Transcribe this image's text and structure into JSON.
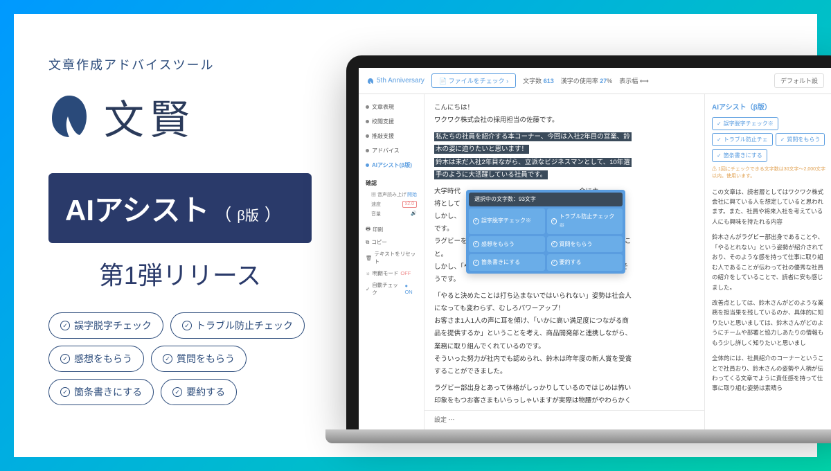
{
  "promo": {
    "tagline": "文章作成アドバイスツール",
    "product_name": "文賢",
    "headline_main": "AIアシスト",
    "headline_sub_open": "（",
    "headline_sub": "β版",
    "headline_sub_close": "）",
    "release": "第1弾リリース",
    "features": [
      "誤字脱字チェック",
      "トラブル防止チェック",
      "感想をもらう",
      "質問をもらう",
      "箇条書きにする",
      "要約する"
    ]
  },
  "app": {
    "topbar": {
      "anniversary": "5th Anniversary",
      "file_check": "ファイルをチェック",
      "char_count_label": "文字数",
      "char_count_value": "613",
      "kanji_ratio_label": "漢字の使用率",
      "kanji_ratio_value": "27",
      "kanji_ratio_unit": "%",
      "display_width_label": "表示幅",
      "default_btn": "デフォルト設"
    },
    "sidebar": {
      "items": [
        "文章表現",
        "校閲支援",
        "推敲支援",
        "アドバイス",
        "AIアシスト(β版)"
      ],
      "active_index": 4,
      "confirm_label": "確認",
      "tts_label": "音声読み上げ",
      "tts_state": "開始",
      "speed_label": "速度",
      "speed_value": "x2.0",
      "volume_label": "音量",
      "controls": {
        "print": "印刷",
        "copy": "コピー",
        "reset": "テキストをリセット",
        "clear_mode": "明朗モード",
        "clear_mode_state": "OFF",
        "auto_check": "自動チェック",
        "auto_check_state": "ON"
      }
    },
    "editor": {
      "lines": {
        "l1": "こんにちは！",
        "l2": "ワクワク株式会社の採用担当の佐藤です。",
        "h1": "私たちの社員を紹介する本コーナー、今回は入社2年目の営業、鈴",
        "h2": "木の姿に迫りたいと思います！",
        "h3": "鈴木は未だ入社2年目ながら、立派なビジネスマンとして、10年選",
        "h4": "手のように大活躍している社員です。",
        "l3a": "大学時代",
        "l3b": "会に主",
        "l4": "将として",
        "l5a": "しかし、",
        "l5b": "うなん",
        "l6": "です。",
        "l7": "ラグビーをはじめたのに深い理由はなくてなんとなく選んだとのこ",
        "l8": "と。",
        "l9": "しかし、「やるからには極めたい」と思い、まじめに取り組んだそ",
        "l10": "うです。",
        "l11": "「やると決めたことは打ち込まないではいられない」姿勢は社会人",
        "l12": "になっても変わらず、むしろパワーアップ！",
        "l13": "お客さま1人1人の声に耳を傾け、「いかに高い満足度につながる商",
        "l14": "品を提供するか」ということを考え、商品開発部と連携しながら、",
        "l15": "業務に取り組んでくれているのです。",
        "l16": "そういった努力が社内でも認められ、鈴木は昨年度の新人賞を受賞",
        "l17": "することができました。",
        "l18": "ラグビー部出身とあって体格がしっかりしているのではじめは怖い",
        "l19": "印象をもつお客さまもいらっしゃいますが実際は物腰がやわらかく"
      },
      "settings_label": "設定"
    },
    "popup": {
      "header": "選択中の文字数：93文字",
      "cells": [
        "誤字脱字チェック※",
        "トラブル防止チェック※",
        "感想をもらう",
        "質問をもらう",
        "箇条書きにする",
        "要約する"
      ]
    },
    "right": {
      "title": "AIアシスト（β版）",
      "chips": [
        "誤字脱字チェック※",
        "トラブル防止チェ",
        "質問をもらう",
        "箇条書きにする"
      ],
      "note": "1回にチェックできる文字数は30文字～2,000文字以内。使用います。",
      "paragraphs": [
        "この文章は、読者層としてはワクワク株式会社に興ている人を想定していると思われます。また、社員や将来入社を考えている人にも興味を持たれる内容",
        "鈴木さんがラグビー部出身であることや、「やるとれない」という姿勢が紹介されており、そのような感を持って仕事に取り組む人であることが伝わって社の優秀な社員の紹介をしていることで、読者に安も感じました。",
        "改善点としては、鈴木さんがどのような業務を担当果を残しているのか、具体的に知りたいと思いましては、鈴木さんがどのようにチームや部署と協力しあたりの情報ももう少し詳しく知りたいと思いまし",
        "全体的には、社員紹介のコーナーということで社員おり、鈴木さんの姿勢や人柄が伝わってくる文章でように責任感を持って仕事に取り組む姿勢は素晴ら"
      ]
    }
  }
}
